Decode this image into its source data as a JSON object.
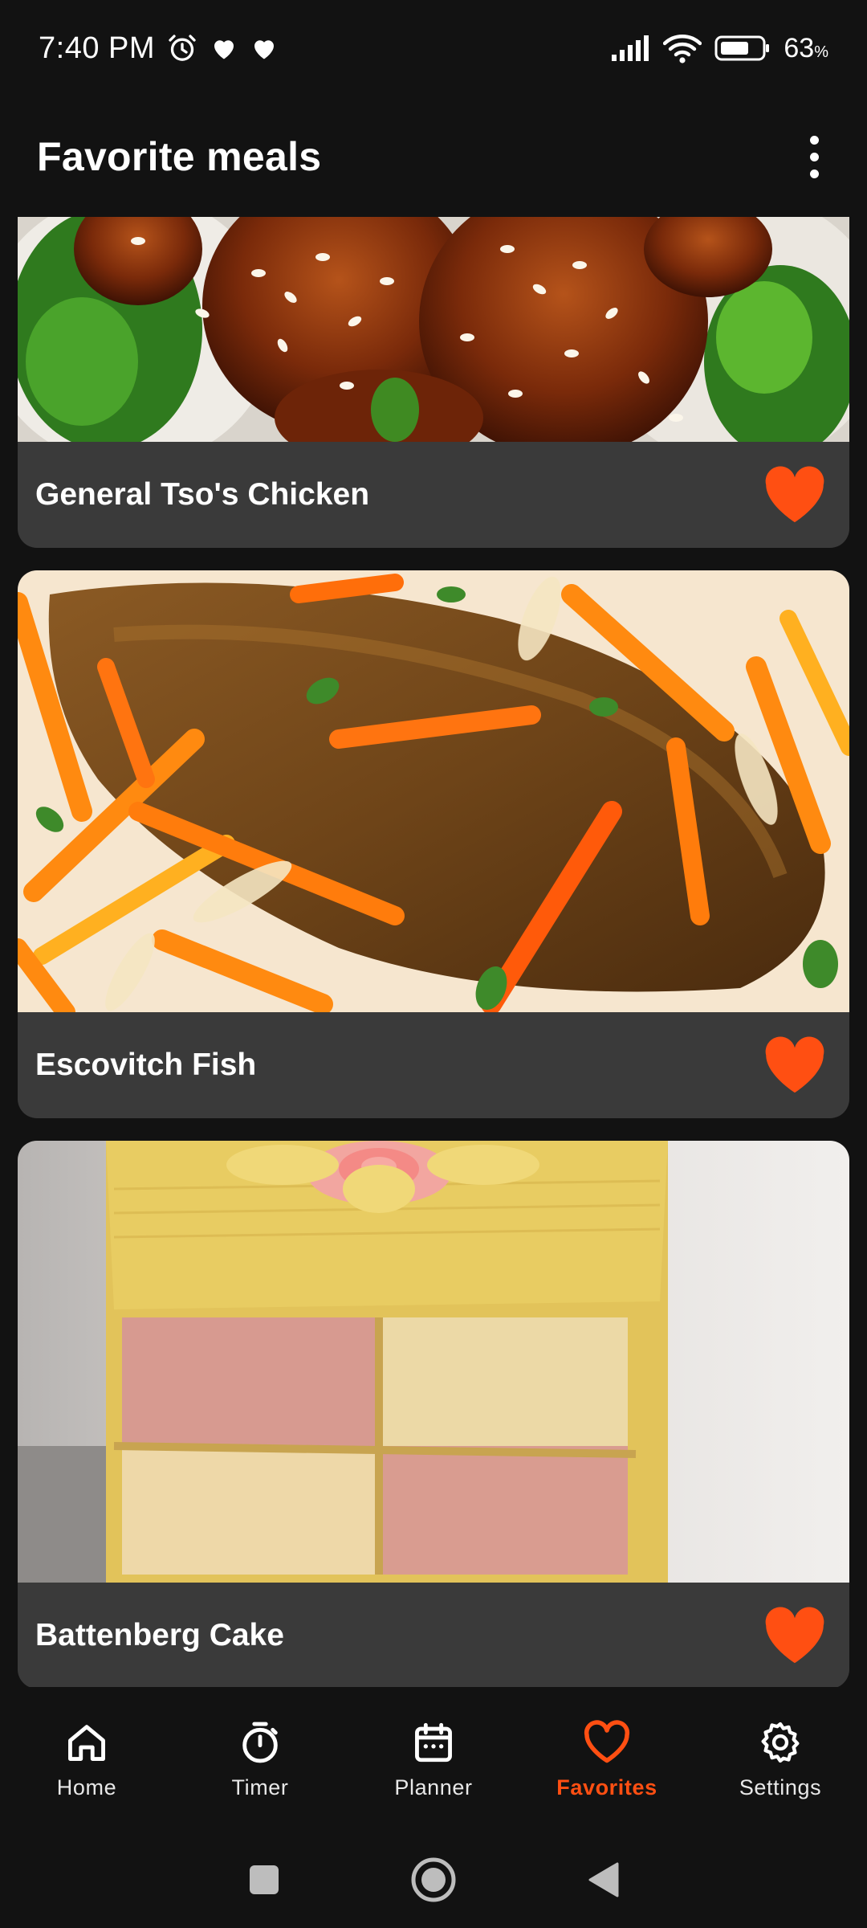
{
  "status_bar": {
    "time": "7:40 PM",
    "battery_percent": "63",
    "battery_unit": "%",
    "icons": [
      "alarm-icon",
      "heart-icon",
      "heart-icon",
      "signal-icon",
      "wifi-icon",
      "battery-icon"
    ]
  },
  "app_bar": {
    "title": "Favorite meals",
    "menu_icon": "more-vert-icon"
  },
  "meals": [
    {
      "name": "General Tso's Chicken",
      "favorite": true
    },
    {
      "name": "Escovitch Fish",
      "favorite": true
    },
    {
      "name": "Battenberg Cake",
      "favorite": true
    }
  ],
  "bottom_nav": {
    "items": [
      {
        "label": "Home",
        "icon": "home-icon"
      },
      {
        "label": "Timer",
        "icon": "timer-icon"
      },
      {
        "label": "Planner",
        "icon": "calendar-icon"
      },
      {
        "label": "Favorites",
        "icon": "heart-outline-icon"
      },
      {
        "label": "Settings",
        "icon": "gear-icon"
      }
    ],
    "active": "Favorites"
  },
  "colors": {
    "accent": "#ff4f12",
    "background": "#121212",
    "card": "#3a3a3a"
  }
}
